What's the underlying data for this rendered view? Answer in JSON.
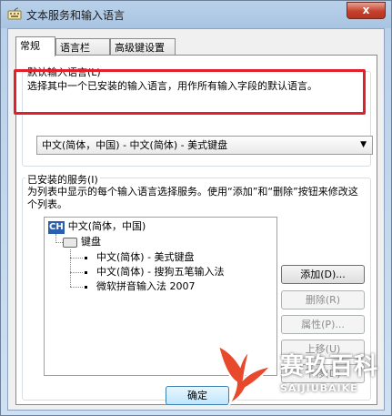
{
  "window": {
    "title": "文本服务和输入语言",
    "close_label": "x"
  },
  "tabs": [
    {
      "label": "常规",
      "active": true
    },
    {
      "label": "语言栏",
      "active": false
    },
    {
      "label": "高级键设置",
      "active": false
    }
  ],
  "default_language": {
    "group_title": "默认输入语言(L)",
    "description": "选择其中一个已安装的输入语言，用作所有输入字段的默认语言。",
    "selected_value": "中文(简体，中国) - 中文(简体) - 美式键盘"
  },
  "installed_services": {
    "group_title": "已安装的服务(I)",
    "description": "为列表中显示的每个输入语言选择服务。使用“添加”和“删除”按钮来修改这个列表。",
    "tree": {
      "language_code": "CH",
      "language": "中文(简体，中国)",
      "category": "键盘",
      "items": [
        "中文(简体) - 美式键盘",
        "中文(简体) - 搜狗五笔输入法",
        "微软拼音输入法 2007"
      ]
    }
  },
  "buttons": {
    "add": "添加(D)...",
    "remove": "删除(R)",
    "properties": "属性(P)...",
    "move_up": "上移(U)",
    "move_down": "下移(D)"
  },
  "footer": {
    "ok": "确定"
  },
  "watermark": {
    "title": "赛玖百科",
    "subtitle": "SAIJIUBAIKE"
  },
  "colors": {
    "highlight": "#e0202a",
    "watermark": "#e8492c"
  }
}
